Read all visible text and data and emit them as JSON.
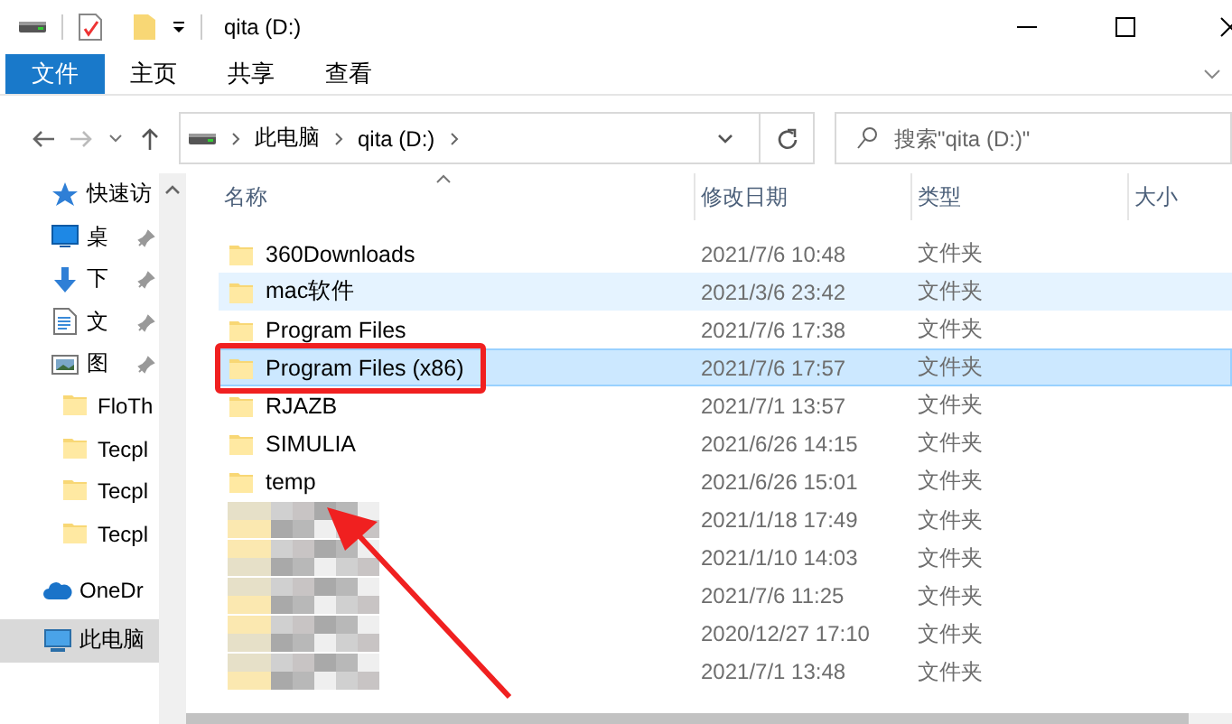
{
  "window": {
    "title": "qita (D:)"
  },
  "ribbon": {
    "file_button": "文件",
    "tabs": [
      "主页",
      "共享",
      "查看"
    ]
  },
  "address": {
    "path": [
      "此电脑",
      "qita (D:)"
    ],
    "search": {
      "placeholder": "搜索\"qita (D:)\""
    }
  },
  "nav": {
    "items": [
      {
        "label": "快速访",
        "kind": "star",
        "pinned": false,
        "selected": false
      },
      {
        "label": "桌",
        "kind": "desktop",
        "pinned": true,
        "selected": false
      },
      {
        "label": "下",
        "kind": "download",
        "pinned": true,
        "selected": false
      },
      {
        "label": "文",
        "kind": "document",
        "pinned": true,
        "selected": false
      },
      {
        "label": "图",
        "kind": "picture",
        "pinned": true,
        "selected": false
      },
      {
        "label": "FloTh",
        "kind": "folder",
        "pinned": false,
        "selected": false
      },
      {
        "label": "Tecpl",
        "kind": "folder",
        "pinned": false,
        "selected": false
      },
      {
        "label": "Tecpl",
        "kind": "folder",
        "pinned": false,
        "selected": false
      },
      {
        "label": "Tecpl",
        "kind": "folder",
        "pinned": false,
        "selected": false
      },
      {
        "label": "OneDr",
        "kind": "cloud",
        "pinned": false,
        "selected": false
      },
      {
        "label": "此电脑",
        "kind": "pc",
        "pinned": false,
        "selected": true
      }
    ]
  },
  "table": {
    "columns": [
      "名称",
      "修改日期",
      "类型",
      "大小"
    ],
    "rows": [
      {
        "name": "360Downloads",
        "modified": "2021/7/6 10:48",
        "type": "文件夹",
        "selected": false,
        "hovered": false,
        "boxed": false
      },
      {
        "name": "mac软件",
        "modified": "2021/3/6 23:42",
        "type": "文件夹",
        "selected": false,
        "hovered": true,
        "boxed": false
      },
      {
        "name": "Program Files",
        "modified": "2021/7/6 17:38",
        "type": "文件夹",
        "selected": false,
        "hovered": false,
        "boxed": false
      },
      {
        "name": "Program Files (x86)",
        "modified": "2021/7/6 17:57",
        "type": "文件夹",
        "selected": true,
        "hovered": false,
        "boxed": true
      },
      {
        "name": "RJAZB",
        "modified": "2021/7/1 13:57",
        "type": "文件夹",
        "selected": false,
        "hovered": false,
        "boxed": false
      },
      {
        "name": "SIMULIA",
        "modified": "2021/6/26 14:15",
        "type": "文件夹",
        "selected": false,
        "hovered": false,
        "boxed": false
      },
      {
        "name": "temp",
        "modified": "2021/6/26 15:01",
        "type": "文件夹",
        "selected": false,
        "hovered": false,
        "boxed": false
      },
      {
        "redacted": true,
        "modified": "2021/1/18 17:49",
        "type": "文件夹",
        "selected": false,
        "hovered": false,
        "boxed": false
      },
      {
        "redacted": true,
        "modified": "2021/1/10 14:03",
        "type": "文件夹",
        "selected": false,
        "hovered": false,
        "boxed": false
      },
      {
        "redacted": true,
        "modified": "2021/7/6 11:25",
        "type": "文件夹",
        "selected": false,
        "hovered": false,
        "boxed": false
      },
      {
        "redacted": true,
        "modified": "2020/12/27 17:10",
        "type": "文件夹",
        "selected": false,
        "hovered": false,
        "boxed": false
      },
      {
        "redacted": true,
        "modified": "2021/7/1 13:48",
        "type": "文件夹",
        "selected": false,
        "hovered": false,
        "boxed": false
      }
    ]
  }
}
